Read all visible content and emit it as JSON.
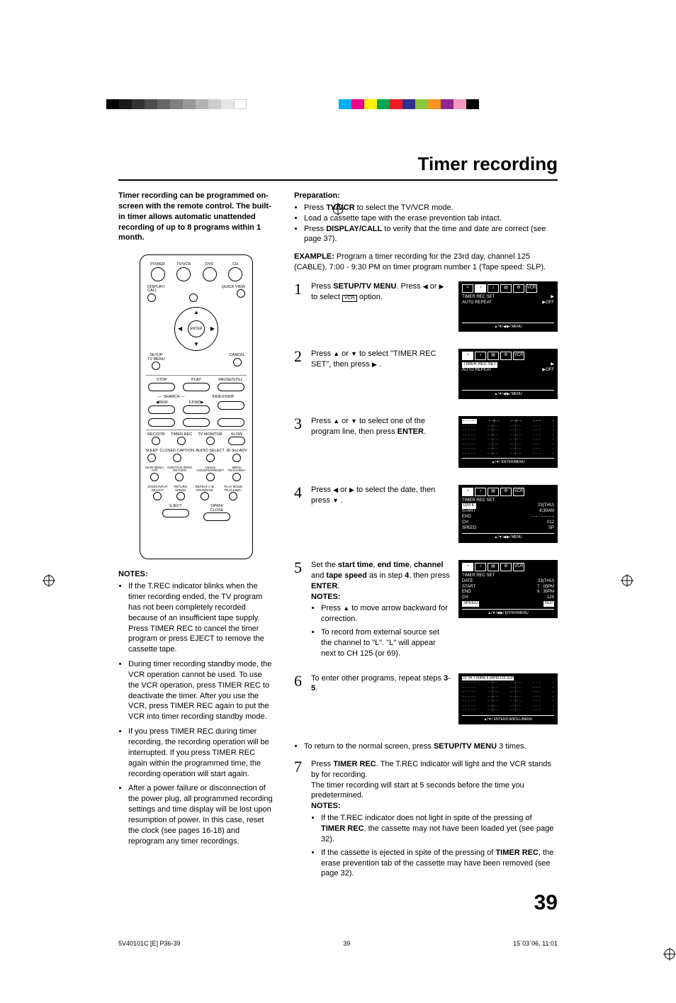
{
  "title": "Timer recording",
  "intro": "Timer recording can be programmed on-screen with the remote control. The built-in timer allows automatic unattended recording of up to 8 programs within 1 month.",
  "remote": {
    "row1": [
      "POWER",
      "TV/VCR",
      "DVD",
      "CH"
    ],
    "display_call": "DISPLAY/\nCALL",
    "quick_view": "QUICK VIEW",
    "enter": "ENTER",
    "setup": "SETUP\nTV MENU",
    "cancel": "CANCEL",
    "transport1": [
      "STOP",
      "PLAY",
      "PAUSE/STILL"
    ],
    "transport2": [
      "— SEARCH —",
      "INDEX/SKIP"
    ],
    "transport2b": [
      "◀REW",
      "F.FWD▶",
      ""
    ],
    "row_small1": [
      "REC/OTR",
      "TIMER REC",
      "TV MONITOR",
      "SLOW"
    ],
    "row_small2": [
      "SLEEP",
      "CLOSED CAPTION",
      "AUDIO SELECT",
      "30 Sec ADV"
    ],
    "row_small3": [
      "MAIN MENU ATR",
      "SUBTITLE ZERO RETURN",
      "ANGLE COUNTER/RESET",
      "MENU TRACKING+"
    ],
    "row_small4": [
      "ZOOM INPUT SELECT",
      "RETURN SPEED",
      "REPEAT A-B PROGRAM",
      "PLAY MODE TRACKING–"
    ],
    "eject": "EJECT",
    "open_close": "OPEN/\nCLOSE"
  },
  "notes_hd": "NOTES:",
  "left_notes": [
    "If the T.REC indicator blinks when the timer recording ended, the TV program has not been completely recorded because of an insufficient tape supply. Press TIMER REC to cancel the timer program or press EJECT to remove the cassette tape.",
    "During timer recording standby mode, the VCR operation cannot be used. To use the VCR operation, press TIMER REC to deactivate the timer. After you use the VCR, press TIMER REC again to put the VCR into timer recording standby mode.",
    "If you press TIMER REC during timer recording, the recording operation will be interrupted. If you press TIMER REC again within the programmed time, the recording operation will start again.",
    "After a power failure or disconnection of the power plug, all programmed recording settings and time display will be lost upon resumption of power. In this case, reset the clock (see pages 16-18) and reprogram any timer recordings."
  ],
  "prep_hd": "Preparation:",
  "prep_items": [
    "Press TV/VCR to select the TV/VCR mode.",
    "Load a cassette tape with the erase prevention tab intact.",
    "Press DISPLAY/CALL to verify that the time and date are correct (see page 37)."
  ],
  "example_label": "EXAMPLE:",
  "example_text": "Program a timer recording for the 23rd day, channel 125 (CABLE), 7:00 - 9:30 PM on timer program number 1 (Tape speed: SLP).",
  "steps": {
    "s1a": "Press ",
    "s1b": "SETUP/TV MENU",
    "s1c": ". Press ",
    "s1d": " or ",
    "s1e": " to select ",
    "s1f": " option.",
    "s2a": "Press ",
    "s2b": "or ",
    "s2c": " to select \"TIMER REC SET\", then press ",
    "s2d": ".",
    "s3a": "Press ",
    "s3b": " or ",
    "s3c": " to select one of the program line, then press ",
    "s3d": "ENTER",
    "s3e": ".",
    "s4a": "Press ",
    "s4b": " or ",
    "s4c": " to select the date, then press ",
    "s4d": ".",
    "s5a": "Set the ",
    "s5b": "start time",
    "s5c": ", ",
    "s5d": "end time",
    "s5e": ", ",
    "s5f": "channel",
    "s5g": " and ",
    "s5h": "tape speed",
    "s5i": " as in step ",
    "s5j": "4",
    "s5k": ", then press ",
    "s5l": "ENTER",
    "s5m": ".",
    "s5notes_hd": "NOTES:",
    "s5n1a": "Press ",
    "s5n1b": " to move arrow backward for correction.",
    "s5n2": "To record from external source set the channel to \"L\". \"L\" will appear next to CH 125 (or 69).",
    "s6a": "To enter other programs, repeat steps ",
    "s6b": "3",
    "s6c": "-",
    "s6d": "5",
    "s6e": ".",
    "s6f": "To return to the normal screen, press ",
    "s6g": "SETUP/TV MENU",
    "s6h": " 3 times.",
    "s7a": "Press ",
    "s7b": "TIMER REC",
    "s7c": ". The T.REC indicator will light and the VCR stands by for recording.",
    "s7d": "The timer recording will start at 5 seconds before the time you predetermined.",
    "s7notes_hd": "NOTES:",
    "s7n1a": "If the T.REC indicator does not light in spite of the pressing of ",
    "s7n1b": "TIMER REC",
    "s7n1c": ", the cassette may not have been loaded yet (see page 32).",
    "s7n2a": "If the cassette is ejected in spite of the pressing of ",
    "s7n2b": "TIMER REC",
    "s7n2c": ", the erase prevention tab of the cassette may have been removed (see page 32)."
  },
  "screens": {
    "menu1": {
      "line1": "TIMER REC SET",
      "line2": "AUTO REPEAT",
      "off": "▶OFF",
      "foot": "▲/▼/◀/▶/ MENU"
    },
    "menu2": {
      "line1_sel": "TIMER REC SET",
      "line2": "AUTO REPEAT",
      "off": "▶OFF",
      "foot": "▲/▼/◀/▶/ MENU"
    },
    "table_empty": {
      "foot": "▲/▼/ ENTER/MENU"
    },
    "detail1": {
      "title": "TIMER REC SET",
      "rows": [
        [
          "DATE",
          "23(THU)"
        ],
        [
          "START",
          "8:30AM"
        ],
        [
          "END",
          "– – : – –  – –"
        ],
        [
          "CH",
          "012"
        ],
        [
          "SPEED",
          "SP"
        ]
      ],
      "foot": "▲/▼/◀/▶/ MENU"
    },
    "detail2": {
      "title": "TIMER REC SET",
      "rows": [
        [
          "DATE",
          "23(THU)"
        ],
        [
          "START",
          "7 : 00PM"
        ],
        [
          "END",
          "9 : 30PM"
        ],
        [
          "CH",
          "125"
        ],
        [
          "SPEED",
          "SLP"
        ]
      ],
      "foot": "▲/▼/◀/▶/ ENTER/MENU"
    },
    "table_filled": {
      "header": "23 TH  7:00PM  9:30PM 125 SLP",
      "foot": "▲/▼/ ENTER/CANCEL/MENU"
    }
  },
  "pagenum": "39",
  "footer": {
    "left": "5V40101C [E] P36-39",
    "mid": "39",
    "right": "15´03´06, 11:01"
  }
}
